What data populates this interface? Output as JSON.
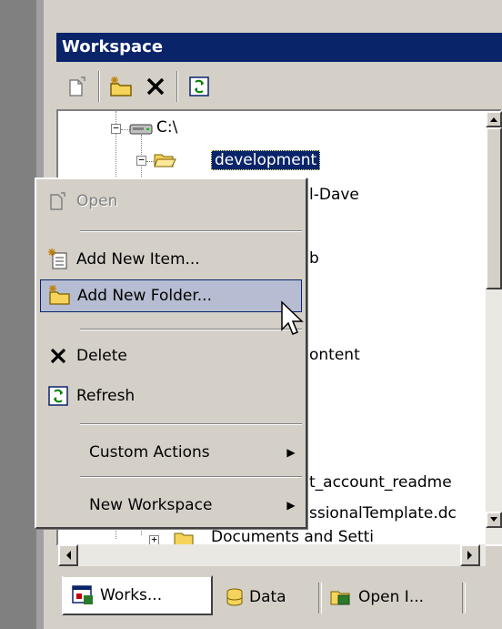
{
  "window": {
    "title": "Workspace"
  },
  "toolbar": {
    "buttons": [
      {
        "icon": "open-doc-icon",
        "label": "Open"
      },
      {
        "icon": "new-folder-icon",
        "label": "Add New Folder"
      },
      {
        "icon": "delete-x-icon",
        "label": "Delete"
      },
      {
        "icon": "refresh-icon",
        "label": "Refresh"
      }
    ]
  },
  "tree": {
    "drive_label": "C:\\",
    "selected_folder": "development",
    "partial_rows": [
      "l-Dave",
      "b",
      "ontent",
      "t_account_readme",
      "ssionalTemplate.dc",
      "Documents and Setti"
    ]
  },
  "context_menu": {
    "items": [
      {
        "label": "Open",
        "disabled": true,
        "icon": "open-doc-icon"
      },
      {
        "label": "Add New Item...",
        "disabled": false,
        "icon": "new-item-icon"
      },
      {
        "label": "Add New Folder...",
        "disabled": false,
        "icon": "new-folder-icon",
        "highlighted": true
      },
      {
        "label": "Delete",
        "disabled": false,
        "icon": "delete-x-icon"
      },
      {
        "label": "Refresh",
        "disabled": false,
        "icon": "refresh-icon"
      },
      {
        "label": "Custom Actions",
        "disabled": false,
        "submenu": true
      },
      {
        "label": "New Workspace",
        "disabled": false,
        "submenu": true
      }
    ]
  },
  "tabs": [
    {
      "label": "Works...",
      "icon": "workspace-tab-icon",
      "active": true
    },
    {
      "label": "Data",
      "icon": "database-icon",
      "active": false
    },
    {
      "label": "Open I...",
      "icon": "open-items-icon",
      "active": false
    }
  ],
  "colors": {
    "title_bar": "#0a246a",
    "selection": "#0a246a",
    "menu_highlight": "#b6bdd2",
    "face": "#d4d0c8"
  }
}
